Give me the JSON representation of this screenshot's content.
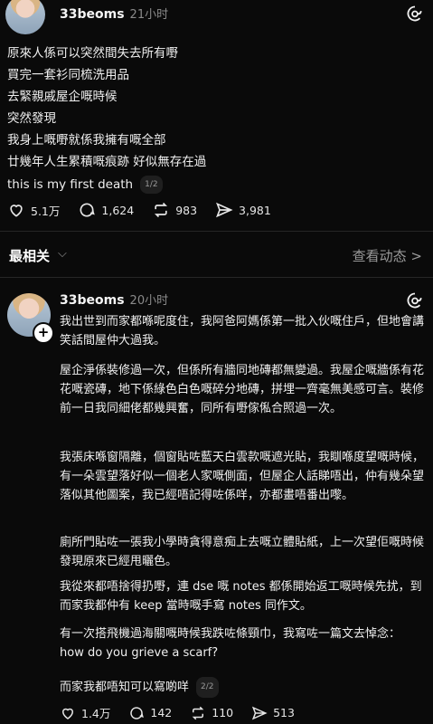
{
  "post": {
    "username": "33beoms",
    "time": "21小时",
    "lines": [
      "原來人係可以突然間失去所有嘢",
      "買完一套衫同梳洗用品",
      "去緊親戚屋企嘅時候",
      "突然發現",
      "我身上嘅嘢就係我擁有嘅全部",
      "廿幾年人生累積嘅痕跡 好似無存在過",
      "this is my first death"
    ],
    "pager": "1/2",
    "likes": "5.1万",
    "comments": "1,624",
    "reposts": "983",
    "shares": "3,981"
  },
  "sort": {
    "label": "最相关",
    "activity": "查看动态 >"
  },
  "reply": {
    "username": "33beoms",
    "time": "20小时",
    "paragraphs": [
      "我出世到而家都喺呢度住，我阿爸阿媽係第一批入伙嘅住戶，但地會講笑話間屋仲大過我。",
      "屋企淨係裝修過一次，但係所有牆同地磚都無變過。我屋企嘅牆係有花花嘅瓷磚，地下係綠色白色嘅碎分地磚，拼埋一齊毫無美感可言。裝修前一日我同細佬都幾興奮，同所有嘢傢俬合照過一次。",
      "我張床喺窗隔離，個窗貼咗藍天白雲款嘅遮光貼，我瞓喺度望嘅時候，有一朵雲望落好似一個老人家嘅側面，但屋企人話睇唔出，仲有幾朵望落似其他圖案，我已經唔記得咗係咩，亦都畫唔番出嚟。",
      "廁所門貼咗一張我小學時貪得意痴上去嘅立體貼紙，上一次望佢嘅時候發現原來已經甩曬色。",
      "我從來都唔捨得扔嘢，連 dse 嘅 notes 都係開始返工嘅時候先扰，到而家我都仲有 keep 當時嘅手寫 notes 同作文。",
      "有一次搭飛機過海關嘅時候我跌咗條頸巾，我寫咗一篇文去悼念：how do you grieve a scarf?",
      "而家我都唔知可以寫啲咩"
    ],
    "pager": "2/2",
    "likes": "1.4万",
    "comments": "142",
    "reposts": "110",
    "shares": "513"
  }
}
